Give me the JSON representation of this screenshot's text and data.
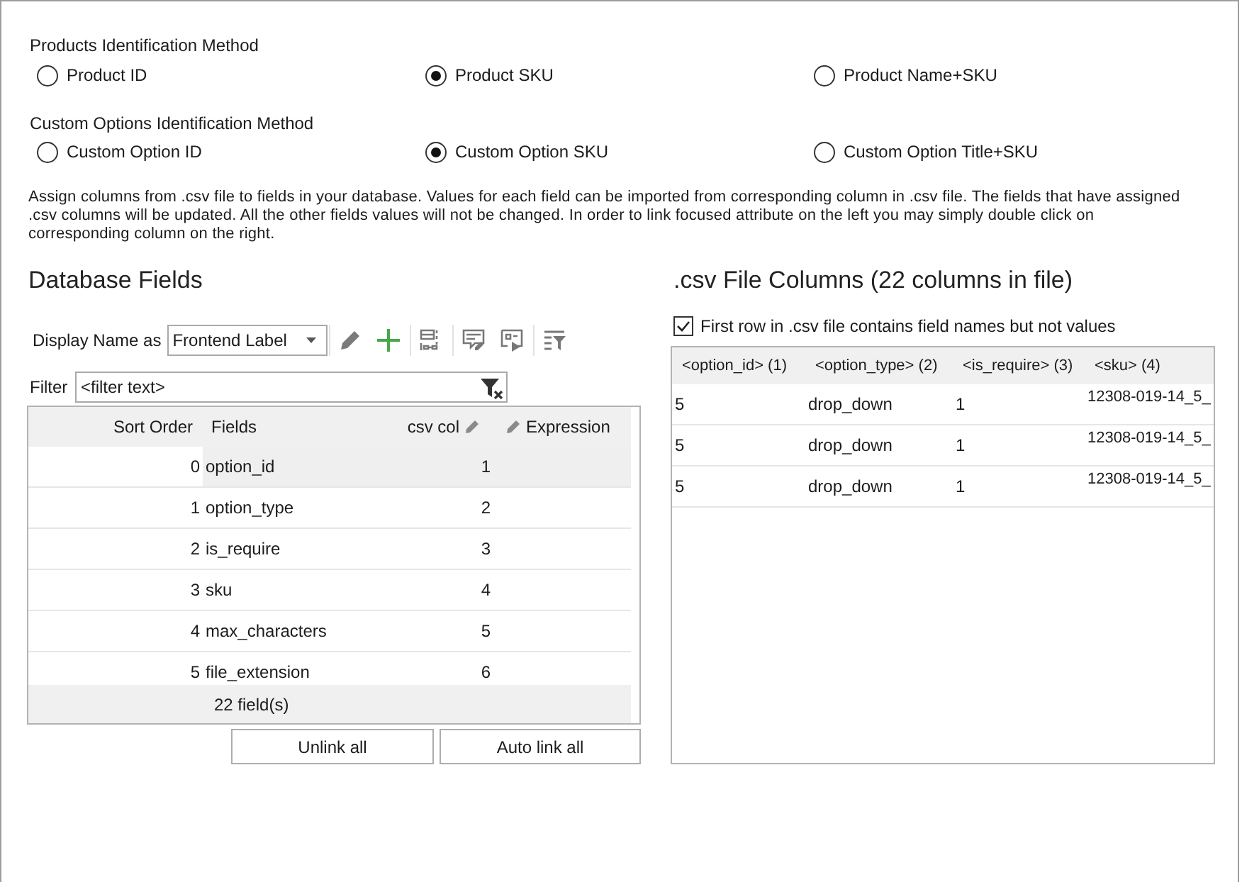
{
  "identification_methods": [
    {
      "label": "Products Identification Method",
      "options": [
        {
          "label": "Product ID",
          "selected": false
        },
        {
          "label": "Product SKU",
          "selected": true
        },
        {
          "label": "Product Name+SKU",
          "selected": false
        }
      ]
    },
    {
      "label": "Custom Options Identification Method",
      "options": [
        {
          "label": "Custom Option ID",
          "selected": false
        },
        {
          "label": "Custom Option SKU",
          "selected": true
        },
        {
          "label": "Custom Option Title+SKU",
          "selected": false
        }
      ]
    }
  ],
  "description": "Assign columns from .csv file to fields in your database. Values for each field can be imported from corresponding column in .csv file. The fields that have assigned .csv columns will be updated. All the other fields values will not be changed. In order to link focused attribute on the left you may simply double click on corresponding column on the right.",
  "database_fields": {
    "title": "Database Fields",
    "display_name": {
      "label": "Display Name as",
      "value": "Frontend Label"
    },
    "filter": {
      "label": "Filter",
      "placeholder": "<filter text>"
    },
    "grid": {
      "columns": [
        "Sort Order",
        "Fields",
        "csv col",
        "Expression"
      ],
      "rows": [
        {
          "sort_order": "0",
          "field": "option_id",
          "csv_col": "1",
          "selected": true
        },
        {
          "sort_order": "1",
          "field": "option_type",
          "csv_col": "2",
          "selected": false
        },
        {
          "sort_order": "2",
          "field": "is_require",
          "csv_col": "3",
          "selected": false
        },
        {
          "sort_order": "3",
          "field": "sku",
          "csv_col": "4",
          "selected": false
        },
        {
          "sort_order": "4",
          "field": "max_characters",
          "csv_col": "5",
          "selected": false
        },
        {
          "sort_order": "5",
          "field": "file_extension",
          "csv_col": "6",
          "selected": false
        }
      ],
      "footer": "22 field(s)"
    },
    "buttons": [
      "Unlink all",
      "Auto link all"
    ]
  },
  "csv_columns": {
    "title": ".csv File Columns (22 columns in file)",
    "first_row_option": {
      "label": "First row in .csv file contains field names but not values",
      "checked": true
    },
    "columns": [
      "<option_id> (1)",
      "<option_type> (2)",
      "<is_require> (3)",
      "<sku> (4)"
    ],
    "rows": [
      [
        "5",
        "drop_down",
        "1",
        "12308-019-14_5_"
      ],
      [
        "5",
        "drop_down",
        "1",
        "12308-019-14_5_"
      ],
      [
        "5",
        "drop_down",
        "1",
        "12308-019-14_5_"
      ]
    ]
  }
}
